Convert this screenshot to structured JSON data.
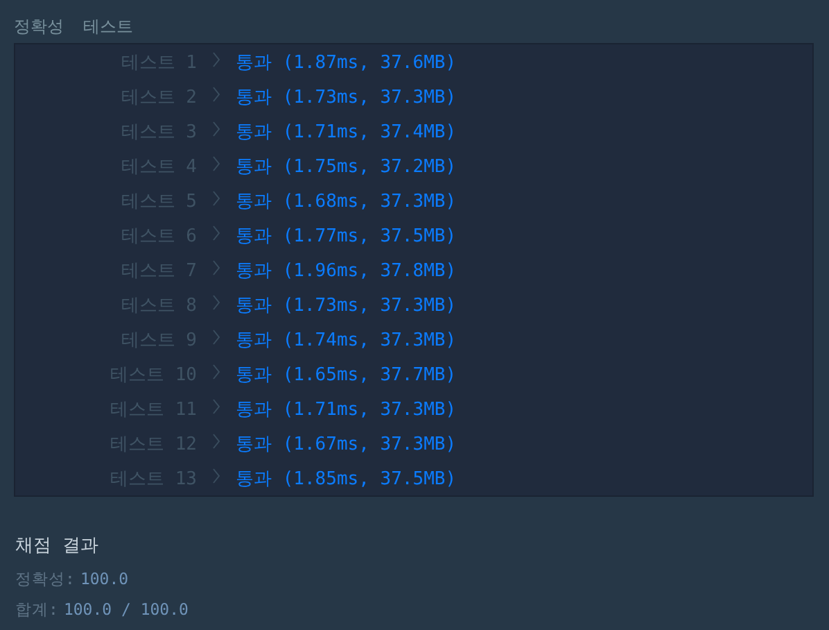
{
  "header": {
    "column_1": "정확성",
    "column_2": "테스트"
  },
  "tests": [
    {
      "label": "테스트 1",
      "result": "통과 (1.87ms, 37.6MB)"
    },
    {
      "label": "테스트 2",
      "result": "통과 (1.73ms, 37.3MB)"
    },
    {
      "label": "테스트 3",
      "result": "통과 (1.71ms, 37.4MB)"
    },
    {
      "label": "테스트 4",
      "result": "통과 (1.75ms, 37.2MB)"
    },
    {
      "label": "테스트 5",
      "result": "통과 (1.68ms, 37.3MB)"
    },
    {
      "label": "테스트 6",
      "result": "통과 (1.77ms, 37.5MB)"
    },
    {
      "label": "테스트 7",
      "result": "통과 (1.96ms, 37.8MB)"
    },
    {
      "label": "테스트 8",
      "result": "통과 (1.73ms, 37.3MB)"
    },
    {
      "label": "테스트 9",
      "result": "통과 (1.74ms, 37.3MB)"
    },
    {
      "label": "테스트 10",
      "result": "통과 (1.65ms, 37.7MB)"
    },
    {
      "label": "테스트 11",
      "result": "통과 (1.71ms, 37.3MB)"
    },
    {
      "label": "테스트 12",
      "result": "통과 (1.67ms, 37.3MB)"
    },
    {
      "label": "테스트 13",
      "result": "통과 (1.85ms, 37.5MB)"
    }
  ],
  "summary": {
    "title": "채점 결과",
    "lines": [
      {
        "label": "정확성:",
        "value": "100.0"
      },
      {
        "label": "합계:",
        "value": "100.0 / 100.0"
      }
    ]
  }
}
